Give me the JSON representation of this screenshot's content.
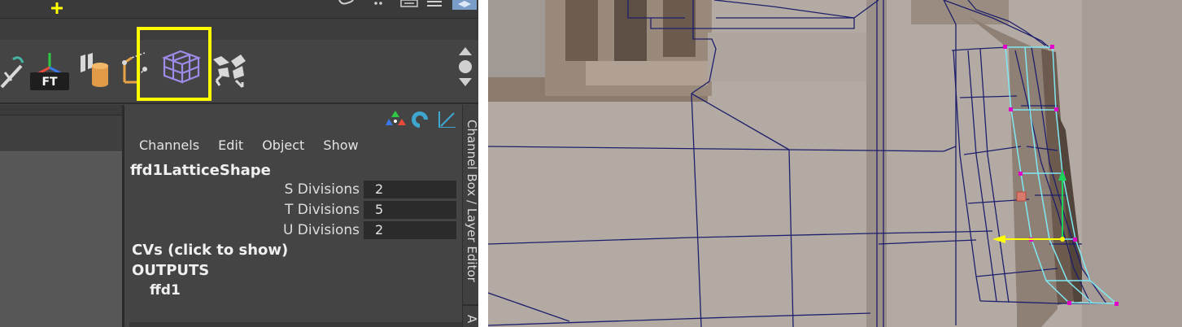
{
  "shelf": {
    "ft_icon_text": "FT",
    "icons": [
      "sculpt-icon",
      "freeze-transform-icon",
      "bend-deformer-icon",
      "cluster-icon",
      "lattice-icon",
      "wrap-deformer-icon"
    ]
  },
  "channel_box": {
    "menu": {
      "channels": "Channels",
      "edit": "Edit",
      "object": "Object",
      "show": "Show"
    },
    "object_name": "ffd1LatticeShape",
    "attributes": [
      {
        "label": "S Divisions",
        "value": "2"
      },
      {
        "label": "T Divisions",
        "value": "5"
      },
      {
        "label": "U Divisions",
        "value": "2"
      }
    ],
    "cvs_text": "CVs (click to show)",
    "outputs_label": "OUTPUTS",
    "output_item": "ffd1"
  },
  "side_tab": {
    "label": "Channel Box / Layer Editor",
    "second_label": "A"
  },
  "colors": {
    "highlight": "#ffff00",
    "lattice": "#7fe8f2",
    "wireframe": "#1e1f6b",
    "lattice_point": "#e000c8",
    "manip_arrow": "#ffff00",
    "manip_y": "#19d35a"
  }
}
